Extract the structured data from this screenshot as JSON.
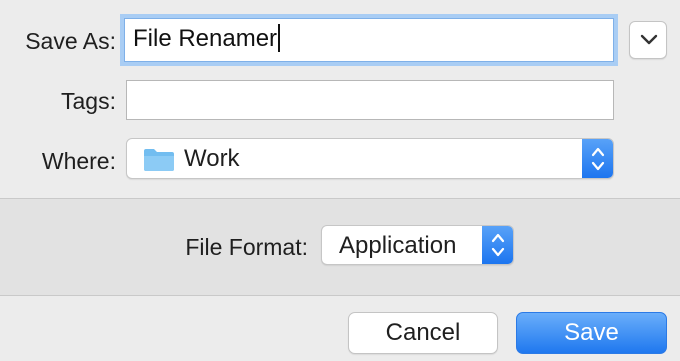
{
  "dialog": {
    "save_as": {
      "label": "Save As:",
      "value": "File Renamer"
    },
    "tags": {
      "label": "Tags:",
      "value": ""
    },
    "where": {
      "label": "Where:",
      "value": "Work",
      "icon": "folder-icon"
    },
    "file_format": {
      "label": "File Format:",
      "value": "Application"
    },
    "buttons": {
      "cancel": "Cancel",
      "save": "Save"
    }
  },
  "colors": {
    "accent": "#1f78ef",
    "folder": "#72bdf0",
    "focus_ring": "#a9cdf4",
    "background": "#ececec"
  }
}
